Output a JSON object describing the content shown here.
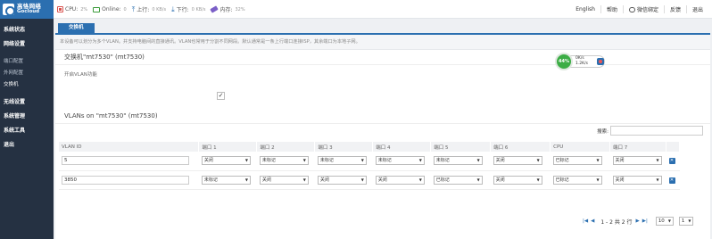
{
  "brand": {
    "name_cn": "高恪网络",
    "name_en": "Gocloud"
  },
  "stats": {
    "cpu_label": "CPU:",
    "cpu_value": "2%",
    "online_label": "Online:",
    "online_value": "0",
    "upload_label": "上行:",
    "upload_value": "0 KB/s",
    "download_label": "下行:",
    "download_value": "0 KB/s",
    "memory_label": "内存:",
    "memory_value": "32%"
  },
  "top_links": {
    "language": "English",
    "help": "帮助",
    "wechat": "微信绑定",
    "switch": "反馈",
    "logout": "退出"
  },
  "sidebar": {
    "items": [
      {
        "label": "系统状态"
      },
      {
        "label": "网络设置",
        "subs": [
          "端口配置",
          "外网配置",
          "交换机"
        ]
      },
      {
        "label": "无线设置"
      },
      {
        "label": "系统管理"
      },
      {
        "label": "系统工具"
      },
      {
        "label": "退出"
      }
    ]
  },
  "tab": {
    "label": "交换机"
  },
  "description": "本设备可以划分为多个VLAN。并支持电脑间的直接通讯。VLAN也常用于分割不同网段。默认通常是一条上行端口连接ISP，其余端口为本地子网。",
  "switch_section": {
    "title": "交换机\"mt7530\" (mt7530)",
    "enable_label": "开启VLAN功能",
    "enable_checked": "✓"
  },
  "gauge": {
    "percent": "44%",
    "up": "0K/s",
    "down": "1.2K/s"
  },
  "vlans_section": {
    "title": "VLANs on \"mt7530\" (mt7530)",
    "search_label": "搜索:",
    "columns": [
      "VLAN ID",
      "端口 1",
      "端口 2",
      "端口 3",
      "端口 4",
      "端口 5",
      "端口 6",
      "CPU",
      "端口 7"
    ],
    "rows": [
      {
        "vlan_id": "5",
        "ports": [
          "关闭",
          "未标记",
          "未标记",
          "未标记",
          "未标记",
          "关闭",
          "已标记",
          "关闭"
        ]
      },
      {
        "vlan_id": "3850",
        "ports": [
          "未标记",
          "关闭",
          "关闭",
          "关闭",
          "已标记",
          "关闭",
          "已标记",
          "关闭"
        ]
      }
    ],
    "pagination": {
      "text": "1 - 2 共 2 行",
      "page_size": "10",
      "page": "1"
    },
    "add_button": "添加"
  },
  "colors": {
    "accent": "#2b6fb0",
    "sidebar_bg": "#253142",
    "add_button": "#5ba6e6"
  }
}
